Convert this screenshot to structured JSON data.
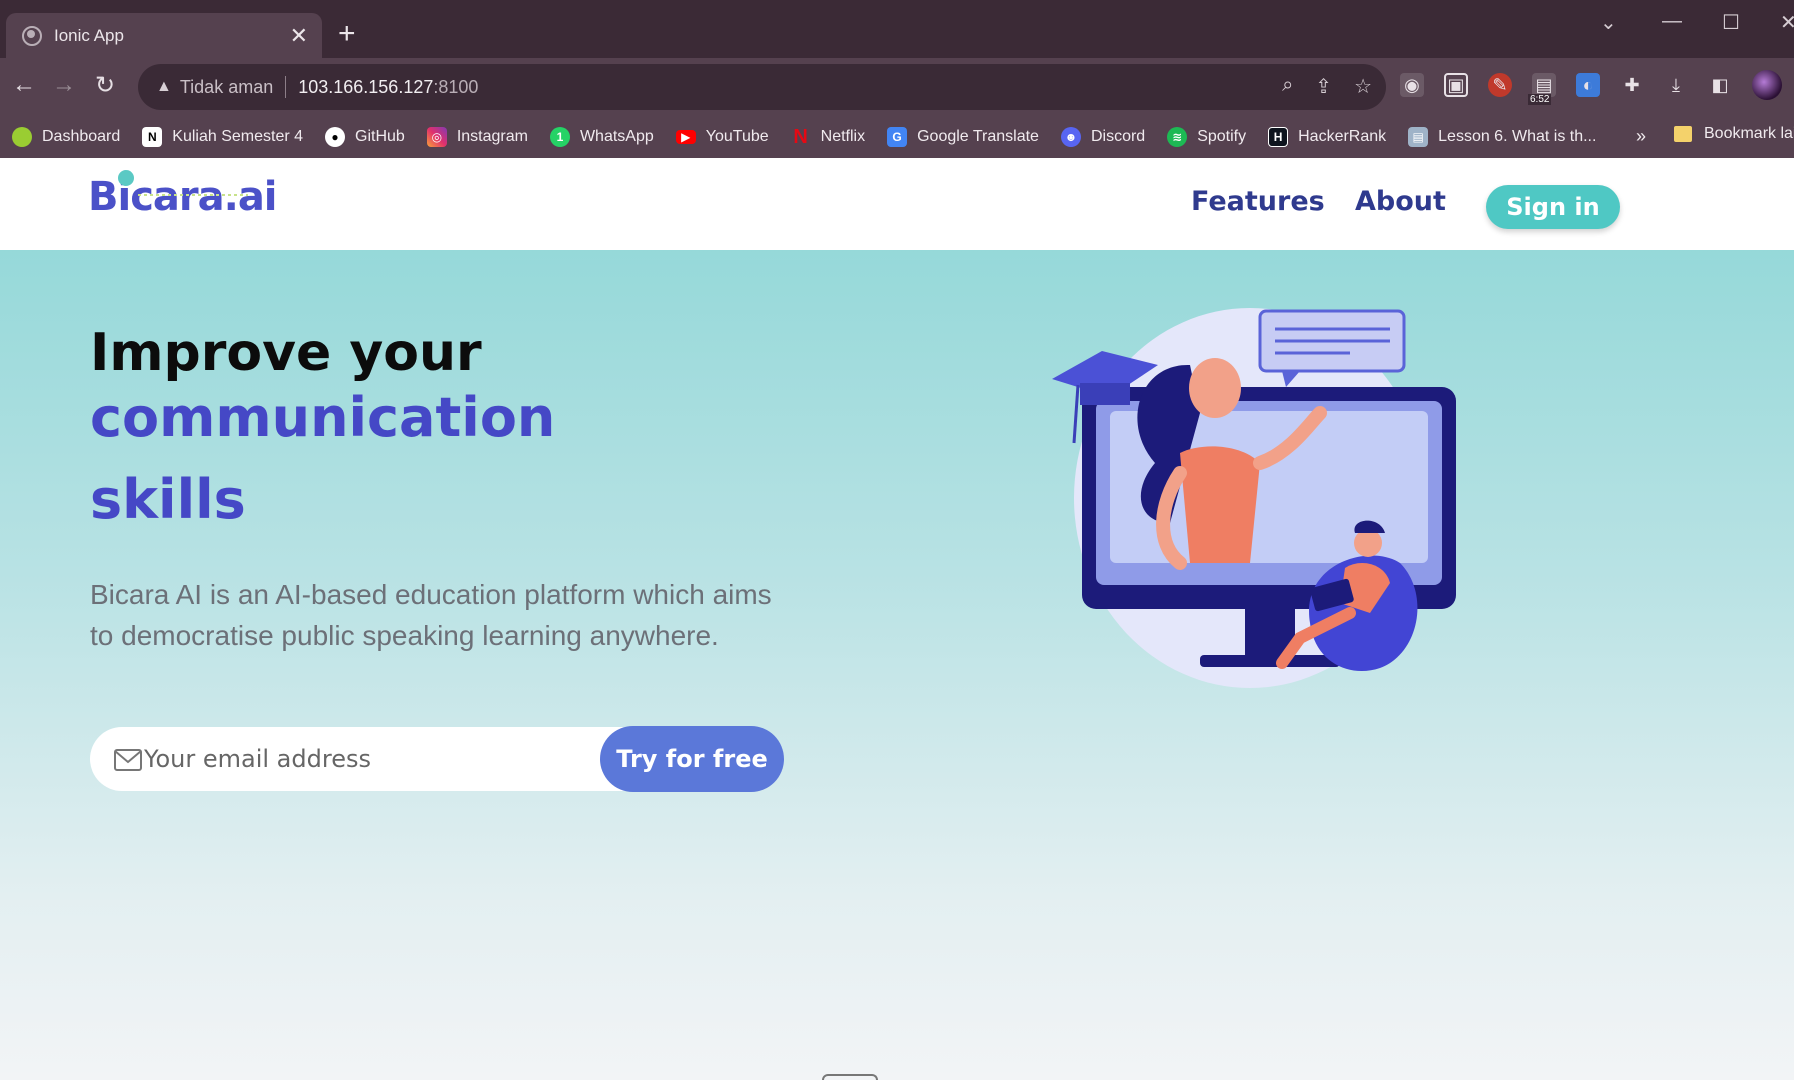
{
  "browser": {
    "tab_title": "Ionic App",
    "tab_close": "✕",
    "new_tab": "+",
    "security_label": "Tidak aman",
    "url_host": "103.166.156.127",
    "url_port": ":8100",
    "ext_timer_badge": "6:52"
  },
  "bookmarks": [
    {
      "label": "Dashboard",
      "icon": "dashboard-icon",
      "color": "#9acd32"
    },
    {
      "label": "Kuliah Semester 4",
      "icon": "notion-icon",
      "color": "#ffffff"
    },
    {
      "label": "GitHub",
      "icon": "github-icon",
      "color": "#ffffff"
    },
    {
      "label": "Instagram",
      "icon": "instagram-icon",
      "color": "#e1306c"
    },
    {
      "label": "WhatsApp",
      "icon": "whatsapp-icon",
      "color": "#25d366"
    },
    {
      "label": "YouTube",
      "icon": "youtube-icon",
      "color": "#ff0000"
    },
    {
      "label": "Netflix",
      "icon": "netflix-icon",
      "color": "#e50914"
    },
    {
      "label": "Google Translate",
      "icon": "google-translate-icon",
      "color": "#4285f4"
    },
    {
      "label": "Discord",
      "icon": "discord-icon",
      "color": "#5865f2"
    },
    {
      "label": "Spotify",
      "icon": "spotify-icon",
      "color": "#1db954"
    },
    {
      "label": "HackerRank",
      "icon": "hackerrank-icon",
      "color": "#0e141e"
    },
    {
      "label": "Lesson 6. What is th...",
      "icon": "lesson-icon",
      "color": "#9fb3c8"
    }
  ],
  "bookmarks_more": "»",
  "bookmarks_folder": "Bookmark lain",
  "site": {
    "logo": "Bicara.ai",
    "nav": {
      "features": "Features",
      "about": "About",
      "signin": "Sign in"
    },
    "hero": {
      "line1": "Improve your",
      "line2": "communication",
      "line3": "skills",
      "description": "Bicara AI is an AI-based education platform which aims to democratise public speaking learning anywhere.",
      "email_placeholder": "Your email address",
      "cta": "Try for free"
    }
  },
  "colors": {
    "accent": "#4548c6",
    "signin_bg": "#4fc8c4",
    "cta_bg": "#5b78d9",
    "nav_text": "#2f3a8e"
  }
}
